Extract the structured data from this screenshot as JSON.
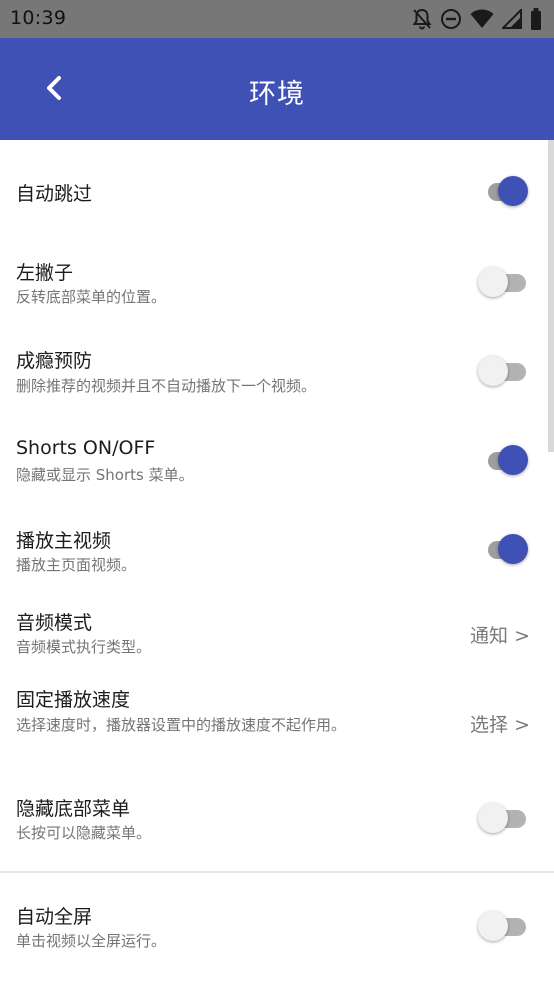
{
  "status_bar": {
    "time": "10:39",
    "icons": [
      "notifications-off-icon",
      "do-not-disturb-icon",
      "wifi-icon",
      "signal-icon",
      "battery-icon"
    ]
  },
  "app_bar": {
    "title": "环境",
    "back_icon": "chevron-left-icon"
  },
  "colors": {
    "primary": "#3f51b5",
    "status_bar": "#777777",
    "text_primary": "#1c1c1c",
    "text_secondary": "#757575"
  },
  "settings": [
    {
      "title": "自动跳过",
      "subtitle": "",
      "type": "toggle",
      "enabled": true
    },
    {
      "title": "左撇子",
      "subtitle": "反转底部菜单的位置。",
      "type": "toggle",
      "enabled": false
    },
    {
      "title": "成瘾预防",
      "subtitle": "删除推荐的视频并且不自动播放下一个视频。",
      "type": "toggle",
      "enabled": false
    },
    {
      "title": "Shorts ON/OFF",
      "subtitle": "隐藏或显示 Shorts 菜单。",
      "type": "toggle",
      "enabled": true
    },
    {
      "title": "播放主视频",
      "subtitle": "播放主页面视频。",
      "type": "toggle",
      "enabled": true
    },
    {
      "title": "音频模式",
      "subtitle": "音频模式执行类型。",
      "type": "value",
      "value": "通知 >"
    },
    {
      "title": "固定播放速度",
      "subtitle": "选择速度时，播放器设置中的播放速度不起作用。",
      "type": "value",
      "value": "选择 >"
    },
    {
      "title": "隐藏底部菜单",
      "subtitle": "长按可以隐藏菜单。",
      "type": "toggle",
      "enabled": false
    },
    {
      "title": "自动全屏",
      "subtitle": "单击视频以全屏运行。",
      "type": "toggle",
      "enabled": false
    }
  ]
}
